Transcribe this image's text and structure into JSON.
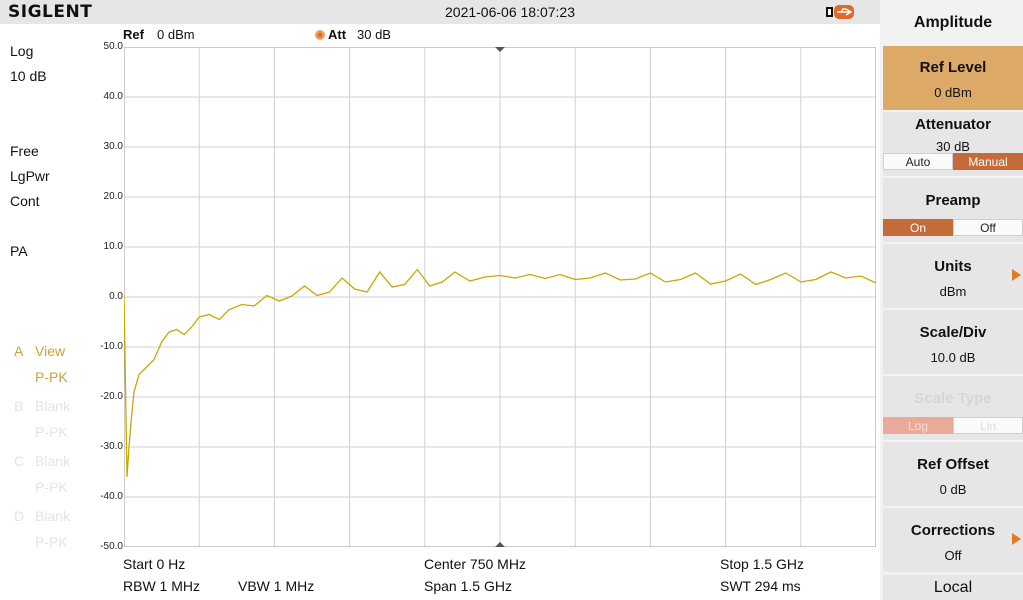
{
  "top_bar": {
    "logo": "SIGLENT",
    "datetime": "2021-06-06 18:07:23",
    "usb_icon": "usb-icon"
  },
  "left_panel": {
    "scale_mode": "Log",
    "scale_div": "10 dB",
    "trig": "Free",
    "avg_type": "LgPwr",
    "sweep_mode": "Cont",
    "preamp": "PA",
    "traces": [
      {
        "letter": "A",
        "state": "View",
        "detector": "P-PK",
        "active": true
      },
      {
        "letter": "B",
        "state": "Blank",
        "detector": "P-PK",
        "active": false
      },
      {
        "letter": "C",
        "state": "Blank",
        "detector": "P-PK",
        "active": false
      },
      {
        "letter": "D",
        "state": "Blank",
        "detector": "P-PK",
        "active": false
      }
    ]
  },
  "header": {
    "ref_label": "Ref",
    "ref_value": "0 dBm",
    "att_label": "Att",
    "att_value": "30 dB"
  },
  "y_axis_labels": [
    "50.0",
    "40.0",
    "30.0",
    "20.0",
    "10.0",
    "0.0",
    "-10.0",
    "-20.0",
    "-30.0",
    "-40.0",
    "-50.0"
  ],
  "bottom": {
    "start": "Start  0 Hz",
    "center": "Center  750 MHz",
    "stop": "Stop  1.5 GHz",
    "rbw": "RBW  1 MHz",
    "vbw": "VBW  1 MHz",
    "span": "Span   1.5 GHz",
    "swt": "SWT  294 ms"
  },
  "softkeys": {
    "menu_title": "Amplitude",
    "ref_level": {
      "title": "Ref Level",
      "value": "0 dBm"
    },
    "attenuator": {
      "title": "Attenuator",
      "value": "30 dB",
      "options": [
        "Auto",
        "Manual"
      ],
      "selected": "Manual"
    },
    "preamp": {
      "title": "Preamp",
      "options": [
        "On",
        "Off"
      ],
      "selected": "On"
    },
    "units": {
      "title": "Units",
      "value": "dBm"
    },
    "scale_div": {
      "title": "Scale/Div",
      "value": "10.0 dB"
    },
    "scale_type": {
      "title": "Scale Type",
      "options": [
        "Log",
        "Lin"
      ],
      "selected": "Log",
      "enabled": false
    },
    "ref_offset": {
      "title": "Ref Offset",
      "value": "0 dB"
    },
    "corrections": {
      "title": "Corrections",
      "value": "Off"
    },
    "local": "Local"
  },
  "colors": {
    "trace": "#c9a800",
    "accent": "#c46b3a",
    "selected_key": "#dcaa66",
    "arrow": "#e27a2a"
  },
  "chart_data": {
    "type": "line",
    "x_unit": "Hz",
    "y_unit": "dBm",
    "xlim": [
      0,
      1500000000
    ],
    "ylim": [
      -50,
      50
    ],
    "grid": true,
    "series": [
      {
        "name": "A",
        "x_mhz": [
          0,
          3,
          6,
          10,
          15,
          20,
          30,
          45,
          60,
          75,
          90,
          105,
          120,
          135,
          150,
          170,
          190,
          210,
          235,
          260,
          285,
          310,
          335,
          360,
          385,
          410,
          435,
          460,
          485,
          510,
          535,
          560,
          585,
          610,
          635,
          660,
          690,
          720,
          750,
          780,
          810,
          840,
          870,
          900,
          930,
          960,
          990,
          1020,
          1050,
          1080,
          1110,
          1140,
          1170,
          1200,
          1230,
          1260,
          1290,
          1320,
          1350,
          1380,
          1410,
          1440,
          1470,
          1500
        ],
        "y_dbm": [
          0.5,
          -18,
          -36,
          -30,
          -24,
          -19,
          -15.5,
          -14,
          -12.5,
          -9,
          -7,
          -6.5,
          -7.5,
          -6,
          -4,
          -3.5,
          -4.5,
          -2.5,
          -1.5,
          -1.8,
          0.3,
          -0.8,
          0.2,
          2.2,
          0.3,
          1.0,
          3.8,
          1.6,
          1.0,
          5.0,
          2.0,
          2.5,
          5.5,
          2.2,
          3.0,
          5.0,
          3.2,
          4.0,
          4.3,
          3.8,
          4.5,
          3.7,
          4.5,
          3.5,
          3.8,
          4.8,
          3.4,
          3.6,
          4.8,
          3.0,
          3.5,
          4.8,
          2.6,
          3.2,
          4.6,
          2.5,
          3.5,
          4.8,
          3.0,
          3.5,
          5.0,
          3.8,
          4.2,
          2.8
        ]
      }
    ]
  }
}
